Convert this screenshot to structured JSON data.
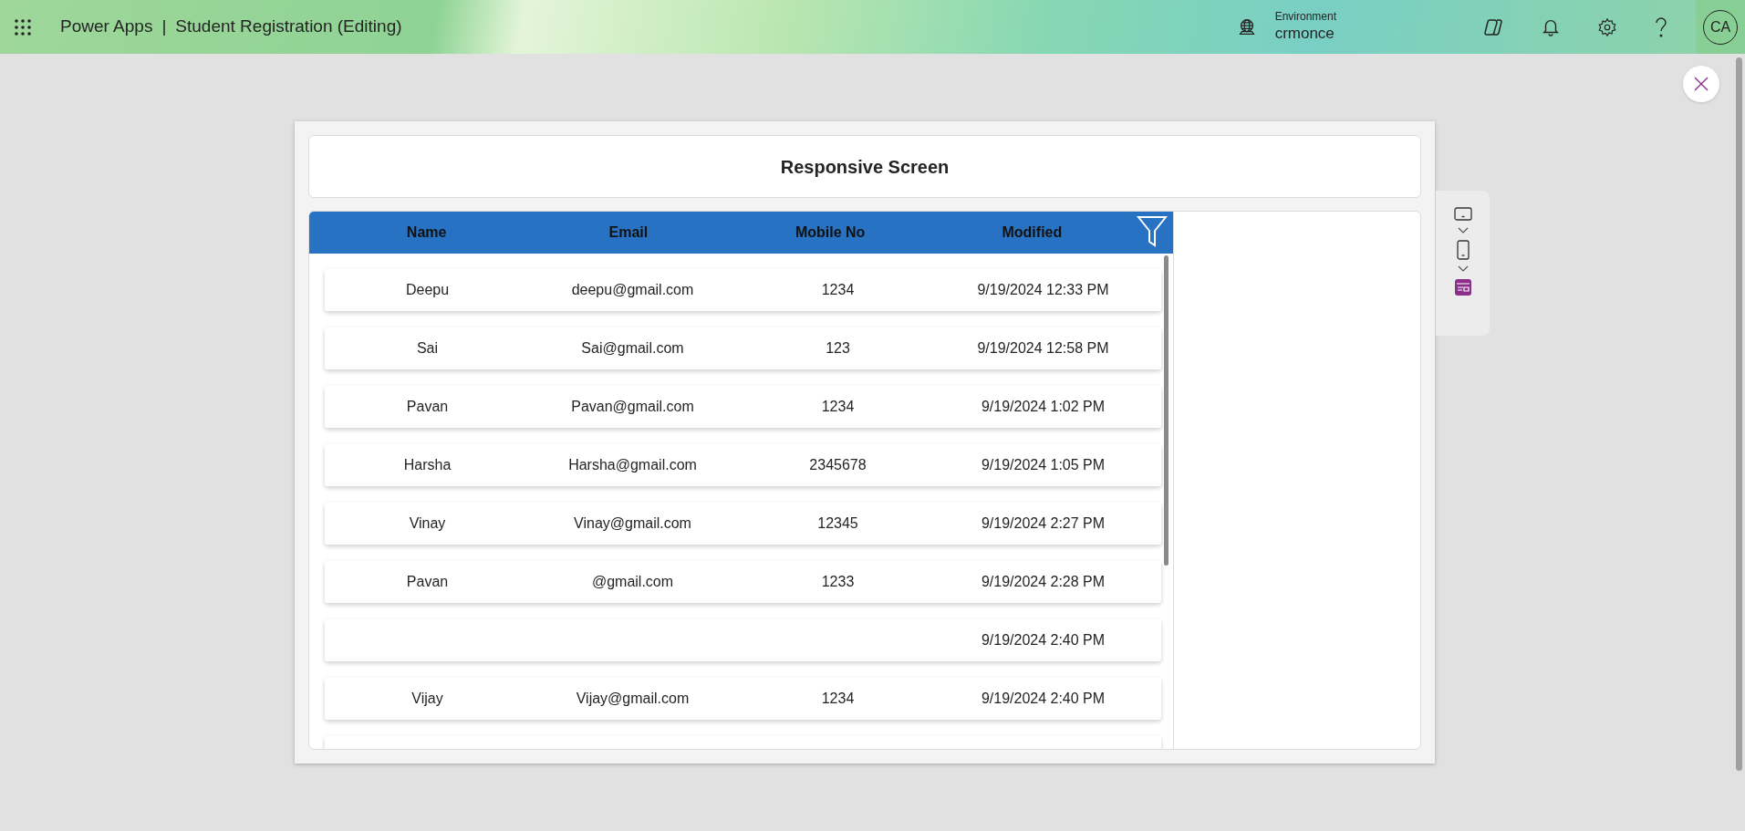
{
  "app_bar": {
    "app_name": "Power Apps",
    "separator": "|",
    "document_title": "Student Registration (Editing)",
    "environment_label": "Environment",
    "environment_name": "crmonce",
    "avatar_initials": "CA"
  },
  "screen": {
    "title": "Responsive Screen",
    "gallery": {
      "columns": [
        "Name",
        "Email",
        "Mobile No",
        "Modified"
      ],
      "rows": [
        {
          "name": "Deepu",
          "email": "deepu@gmail.com",
          "mobile": "1234",
          "modified": "9/19/2024 12:33 PM"
        },
        {
          "name": "Sai",
          "email": "Sai@gmail.com",
          "mobile": "123",
          "modified": "9/19/2024 12:58 PM"
        },
        {
          "name": "Pavan",
          "email": "Pavan@gmail.com",
          "mobile": "1234",
          "modified": "9/19/2024 1:02 PM"
        },
        {
          "name": "Harsha",
          "email": "Harsha@gmail.com",
          "mobile": "2345678",
          "modified": "9/19/2024 1:05 PM"
        },
        {
          "name": "Vinay",
          "email": "Vinay@gmail.com",
          "mobile": "12345",
          "modified": "9/19/2024 2:27 PM"
        },
        {
          "name": "Pavan",
          "email": "@gmail.com",
          "mobile": "1233",
          "modified": "9/19/2024 2:28 PM"
        },
        {
          "modified": "9/19/2024 2:40 PM"
        },
        {
          "name": "Vijay",
          "email": "Vijay@gmail.com",
          "mobile": "1234",
          "modified": "9/19/2024 2:40 PM"
        }
      ]
    }
  }
}
